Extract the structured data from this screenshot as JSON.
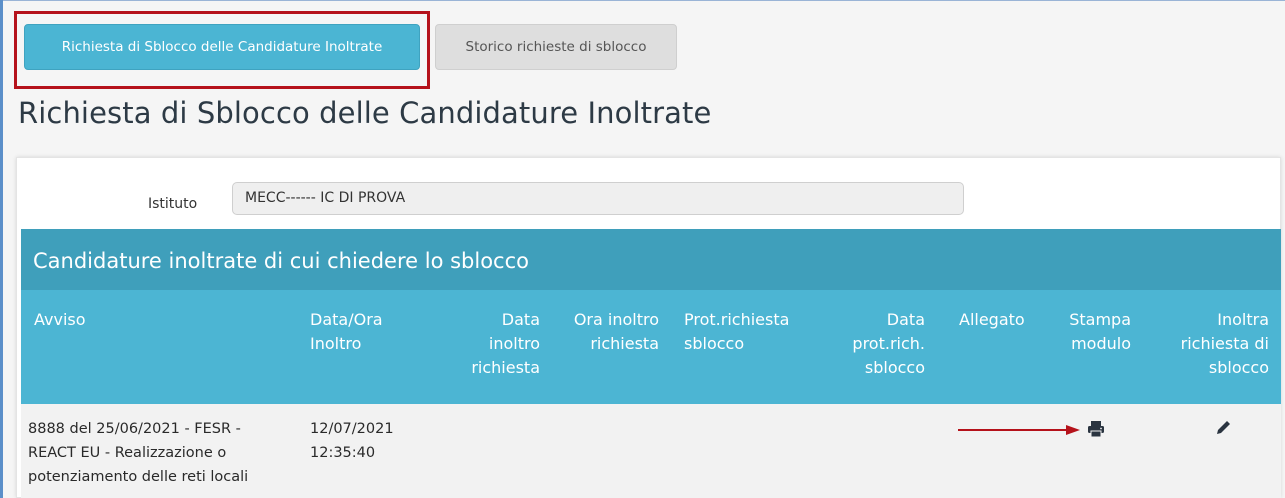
{
  "tabs": [
    {
      "label": "Richiesta di Sblocco delle Candidature Inoltrate",
      "active": true
    },
    {
      "label": "Storico richieste di sblocco",
      "active": false
    }
  ],
  "page_title": "Richiesta di Sblocco delle Candidature Inoltrate",
  "form": {
    "istituto_label": "Istituto",
    "istituto_value": "MECC------ IC DI PROVA"
  },
  "section_title": "Candidature inoltrate di cui chiedere lo sblocco",
  "table": {
    "headers": [
      {
        "lines": [
          "Avviso"
        ]
      },
      {
        "lines": [
          "Data/Ora",
          "Inoltro"
        ]
      },
      {
        "lines": [
          "Data",
          "inoltro",
          "richiesta"
        ]
      },
      {
        "lines": [
          "Ora inoltro",
          "richiesta"
        ]
      },
      {
        "lines": [
          "Prot.richiesta",
          "sblocco"
        ]
      },
      {
        "lines": [
          "Data",
          "prot.rich.",
          "sblocco"
        ]
      },
      {
        "lines": [
          "Allegato"
        ]
      },
      {
        "lines": [
          "Stampa",
          "modulo"
        ]
      },
      {
        "lines": [
          "Inoltra",
          "richiesta di",
          "sblocco"
        ]
      }
    ],
    "rows": [
      {
        "avviso_lines": [
          "8888 del 25/06/2021 - FESR -",
          "REACT EU - Realizzazione o",
          "potenziamento delle reti locali"
        ],
        "data_ora_lines": [
          "12/07/2021",
          "12:35:40"
        ],
        "stampa_icon": "printer-icon",
        "inoltra_icon": "pencil-icon"
      }
    ]
  },
  "colors": {
    "tab_active": "#4bb5d3",
    "section_header": "#3f9fbb",
    "table_header": "#4cb5d3",
    "highlight": "#b5121b"
  }
}
